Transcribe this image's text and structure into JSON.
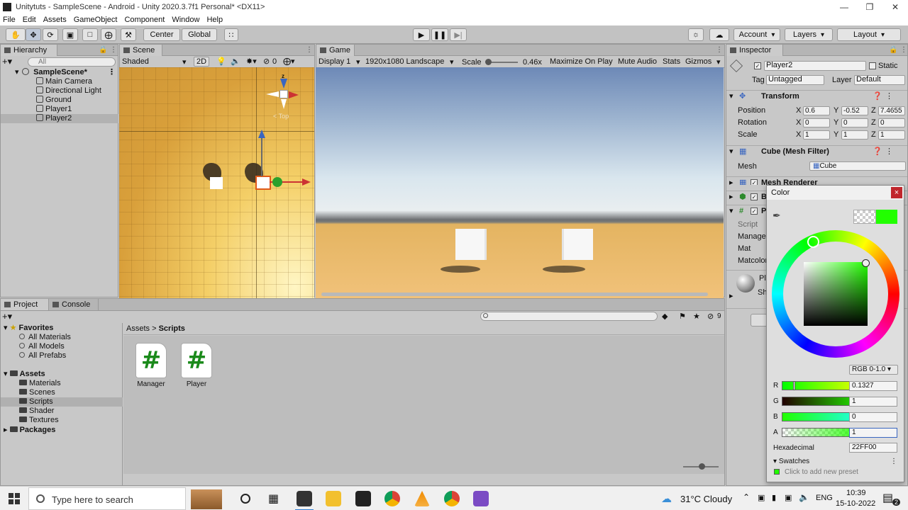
{
  "window": {
    "title": "Unitytuts - SampleScene - Android - Unity 2020.3.7f1 Personal* <DX11>",
    "controls": [
      "—",
      "❐",
      "✕"
    ]
  },
  "menu": [
    "File",
    "Edit",
    "Assets",
    "GameObject",
    "Component",
    "Window",
    "Help"
  ],
  "toolbar": {
    "pivot": "Center",
    "space": "Global",
    "account": "Account",
    "layers": "Layers",
    "layout": "Layout"
  },
  "hierarchy": {
    "tab": "Hierarchy",
    "search_placeholder": "All",
    "scene": "SampleScene*",
    "items": [
      "Main Camera",
      "Directional Light",
      "Ground",
      "Player1",
      "Player2"
    ]
  },
  "scene": {
    "tab": "Scene",
    "shading": "Shaded",
    "mode2d": "2D",
    "gizmo_count": "0",
    "view_label": "Top",
    "gizmo_axis": "z"
  },
  "game": {
    "tab": "Game",
    "display": "Display 1",
    "resolution": "1920x1080 Landscape",
    "scale_label": "Scale",
    "scale_value": "0.46x",
    "maximize": "Maximize On Play",
    "mute": "Mute Audio",
    "stats": "Stats",
    "gizmos": "Gizmos"
  },
  "project": {
    "tabs": [
      "Project",
      "Console"
    ],
    "favorites": "Favorites",
    "favorite_items": [
      "All Materials",
      "All Models",
      "All Prefabs"
    ],
    "assets": "Assets",
    "asset_folders": [
      "Materials",
      "Scenes",
      "Scripts",
      "Shader",
      "Textures"
    ],
    "packages": "Packages",
    "breadcrumb_root": "Assets",
    "breadcrumb_sep": ">",
    "breadcrumb_current": "Scripts",
    "files": [
      "Manager",
      "Player"
    ],
    "file_glyph": "#",
    "hidden_count": "9"
  },
  "inspector": {
    "tab": "Inspector",
    "object_name": "Player2",
    "static": "Static",
    "tag_label": "Tag",
    "tag": "Untagged",
    "layer_label": "Layer",
    "layer": "Default",
    "transform": "Transform",
    "position_label": "Position",
    "rotation_label": "Rotation",
    "scale_label": "Scale",
    "position": [
      "0.6",
      "-0.52",
      "7.4655"
    ],
    "rotation": [
      "0",
      "0",
      "0"
    ],
    "scale": [
      "1",
      "1",
      "1"
    ],
    "axes": [
      "X",
      "Y",
      "Z"
    ],
    "mesh_filter": "Cube (Mesh Filter)",
    "mesh_label": "Mesh",
    "mesh_value": "Cube",
    "mesh_renderer": "Mesh Renderer",
    "collapsed_b": "B",
    "collapsed_p": "P",
    "script_rows": [
      "Script",
      "Manager",
      "Mat",
      "Matcolor"
    ],
    "material_rows": [
      "Pl",
      "Sh"
    ]
  },
  "color_picker": {
    "title": "Color",
    "close": "×",
    "mode": "RGB 0-1.0",
    "channels": [
      {
        "label": "R",
        "value": "0.1327"
      },
      {
        "label": "G",
        "value": "1"
      },
      {
        "label": "B",
        "value": "0"
      },
      {
        "label": "A",
        "value": "1"
      }
    ],
    "hex_label": "Hexadecimal",
    "hex_value": "22FF00",
    "swatches": "Swatches",
    "swatch_hint": "Click to add new preset",
    "current_color": "#22ff00"
  },
  "taskbar": {
    "search_placeholder": "Type here to search",
    "weather": "31°C Cloudy",
    "lang": "ENG",
    "time": "10:39",
    "date": "15-10-2022",
    "notif_count": "2"
  }
}
